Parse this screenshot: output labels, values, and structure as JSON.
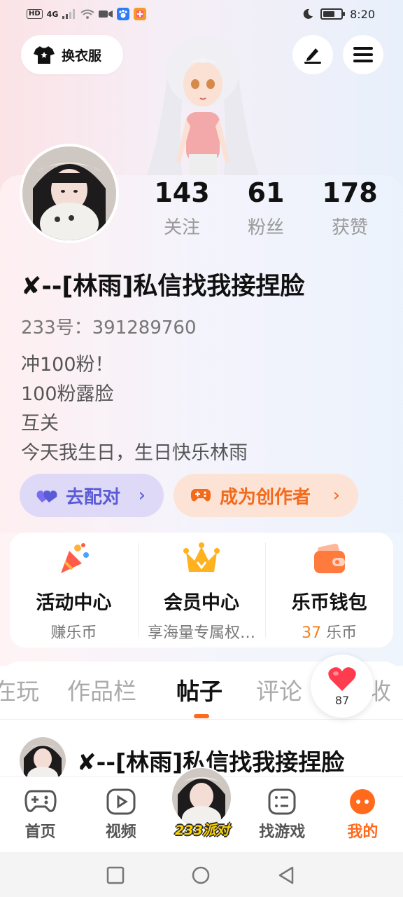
{
  "status_bar": {
    "hd_label": "HD",
    "signal_label": "4G",
    "time": "8:20",
    "battery_level": 0.65
  },
  "header": {
    "outfit_label": "换衣服",
    "icons": [
      "shirt-icon",
      "edit-icon",
      "menu-icon"
    ]
  },
  "profile": {
    "stats": [
      {
        "value": "143",
        "label": "关注"
      },
      {
        "value": "61",
        "label": "粉丝"
      },
      {
        "value": "178",
        "label": "获赞"
      }
    ],
    "nickname": "✘--[林雨]私信找我接捏脸",
    "uid": "233号：391289760",
    "bio": [
      "冲100粉！",
      "100粉露脸",
      "互关",
      "今天我生日，生日快乐林雨"
    ],
    "match_label": "去配对",
    "creator_label": "成为创作者"
  },
  "services": [
    {
      "title": "活动中心",
      "sub": "赚乐币",
      "icon": "party-popper-icon"
    },
    {
      "title": "会员中心",
      "sub": "享海量专属权…",
      "icon": "crown-icon"
    },
    {
      "title": "乐币钱包",
      "coin": "37",
      "sub": "乐币",
      "icon": "wallet-icon"
    }
  ],
  "tabs": [
    {
      "label": "在玩"
    },
    {
      "label": "作品栏"
    },
    {
      "label": "帖子",
      "active": true
    },
    {
      "label": "评论"
    },
    {
      "label": "收"
    }
  ],
  "like_badge": {
    "count": "87"
  },
  "post": {
    "author": "✘--[林雨]私信找我接捏脸"
  },
  "bottom_nav": [
    {
      "label": "首页",
      "icon": "gamepad-icon"
    },
    {
      "label": "视频",
      "icon": "play-icon"
    },
    {
      "label": "233派对",
      "icon": "party-avatar"
    },
    {
      "label": "找游戏",
      "icon": "list-icon"
    },
    {
      "label": "我的",
      "icon": "profile-face-icon",
      "active": true
    }
  ],
  "colors": {
    "accent_orange": "#ff6a1c",
    "match_purple": "#5b5bd6",
    "creator_orange": "#f26a1b"
  }
}
